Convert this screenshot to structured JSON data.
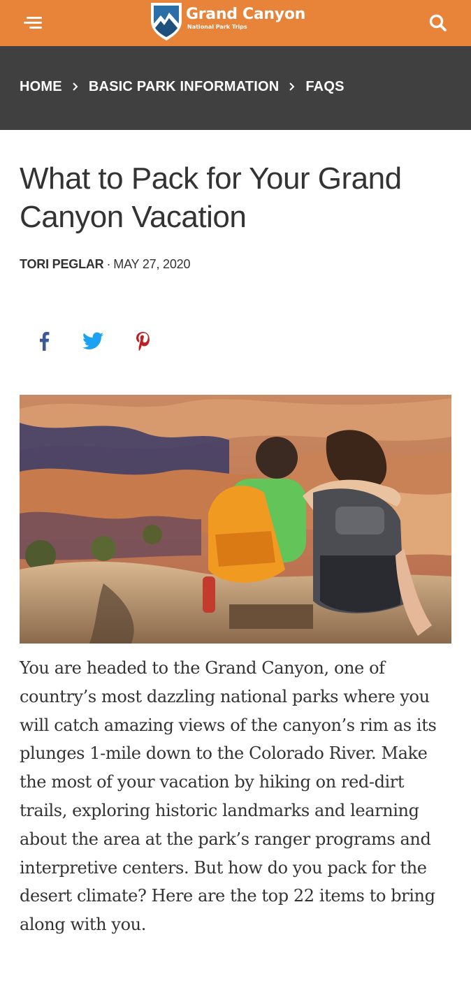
{
  "header": {
    "brand_title": "Grand Canyon",
    "brand_subtitle": "National Park Trips",
    "brand_color": "#e8843a"
  },
  "breadcrumb": {
    "items": [
      "HOME",
      "BASIC PARK INFORMATION",
      "FAQS"
    ],
    "background": "#404040"
  },
  "article": {
    "title": "What to Pack for Your Grand Canyon Vacation",
    "author": "TORI PEGLAR",
    "separator": "·",
    "date": "MAY 27, 2020",
    "share_icons": [
      "facebook-icon",
      "twitter-icon",
      "pinterest-icon"
    ],
    "body": "You are headed to the Grand Canyon, one of country’s most dazzling national parks where you will catch amazing views of the canyon’s rim as its plunges 1-mile down to the Colorado River. Make the most of your vacation by hiking on red-dirt trails, exploring historic landmarks and learning about the area at the park’s ranger programs and interpretive centers. But how do you pack for the desert climate? Here are the top 22 items to bring along with you."
  }
}
